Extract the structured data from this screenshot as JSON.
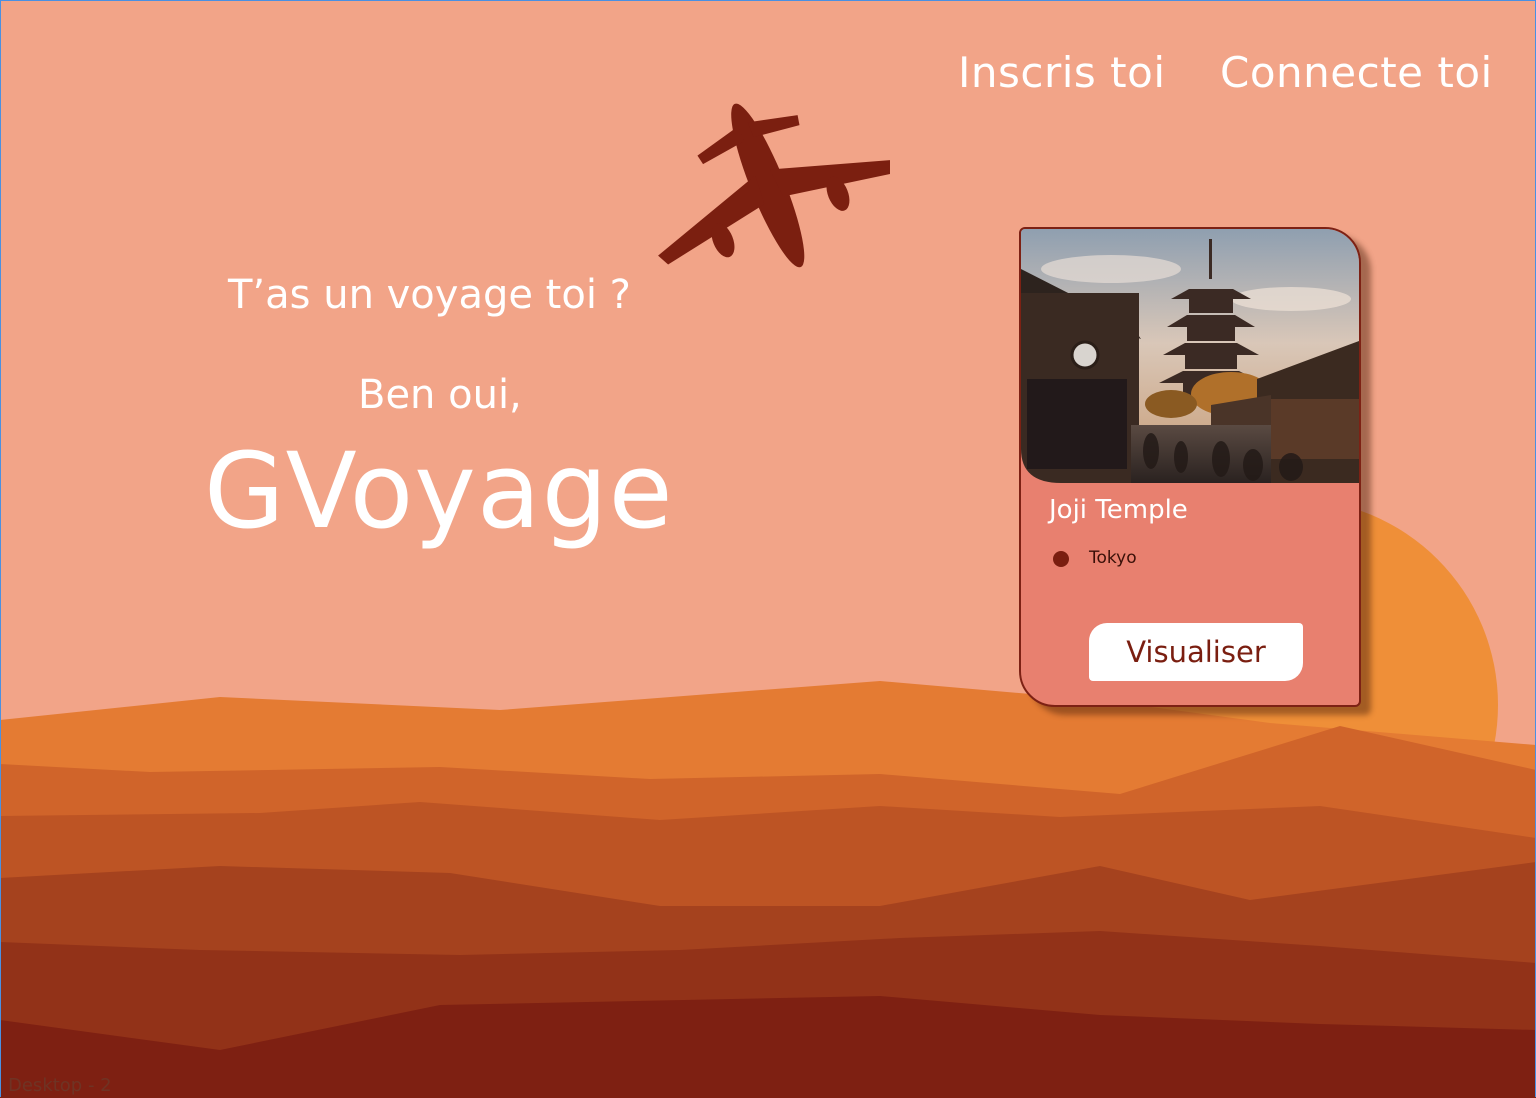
{
  "nav": {
    "signup_label": "Inscris toi",
    "login_label": "Connecte toi"
  },
  "hero": {
    "tagline": "T’as un voyage toi ?",
    "subline": "Ben oui,",
    "brand": "GVoyage"
  },
  "card": {
    "title": "Joji Temple",
    "location": "Tokyo",
    "button_label": "Visualiser"
  },
  "frame_label": "Desktop - 2",
  "colors": {
    "sky": "#f2a488",
    "sun": "#ef8f38",
    "card": "#e8806f",
    "accent_dark": "#7a1e10",
    "text_light": "#ffffff"
  },
  "icons": {
    "plane": "airplane-silhouette-icon",
    "location": "location-dot-icon"
  }
}
